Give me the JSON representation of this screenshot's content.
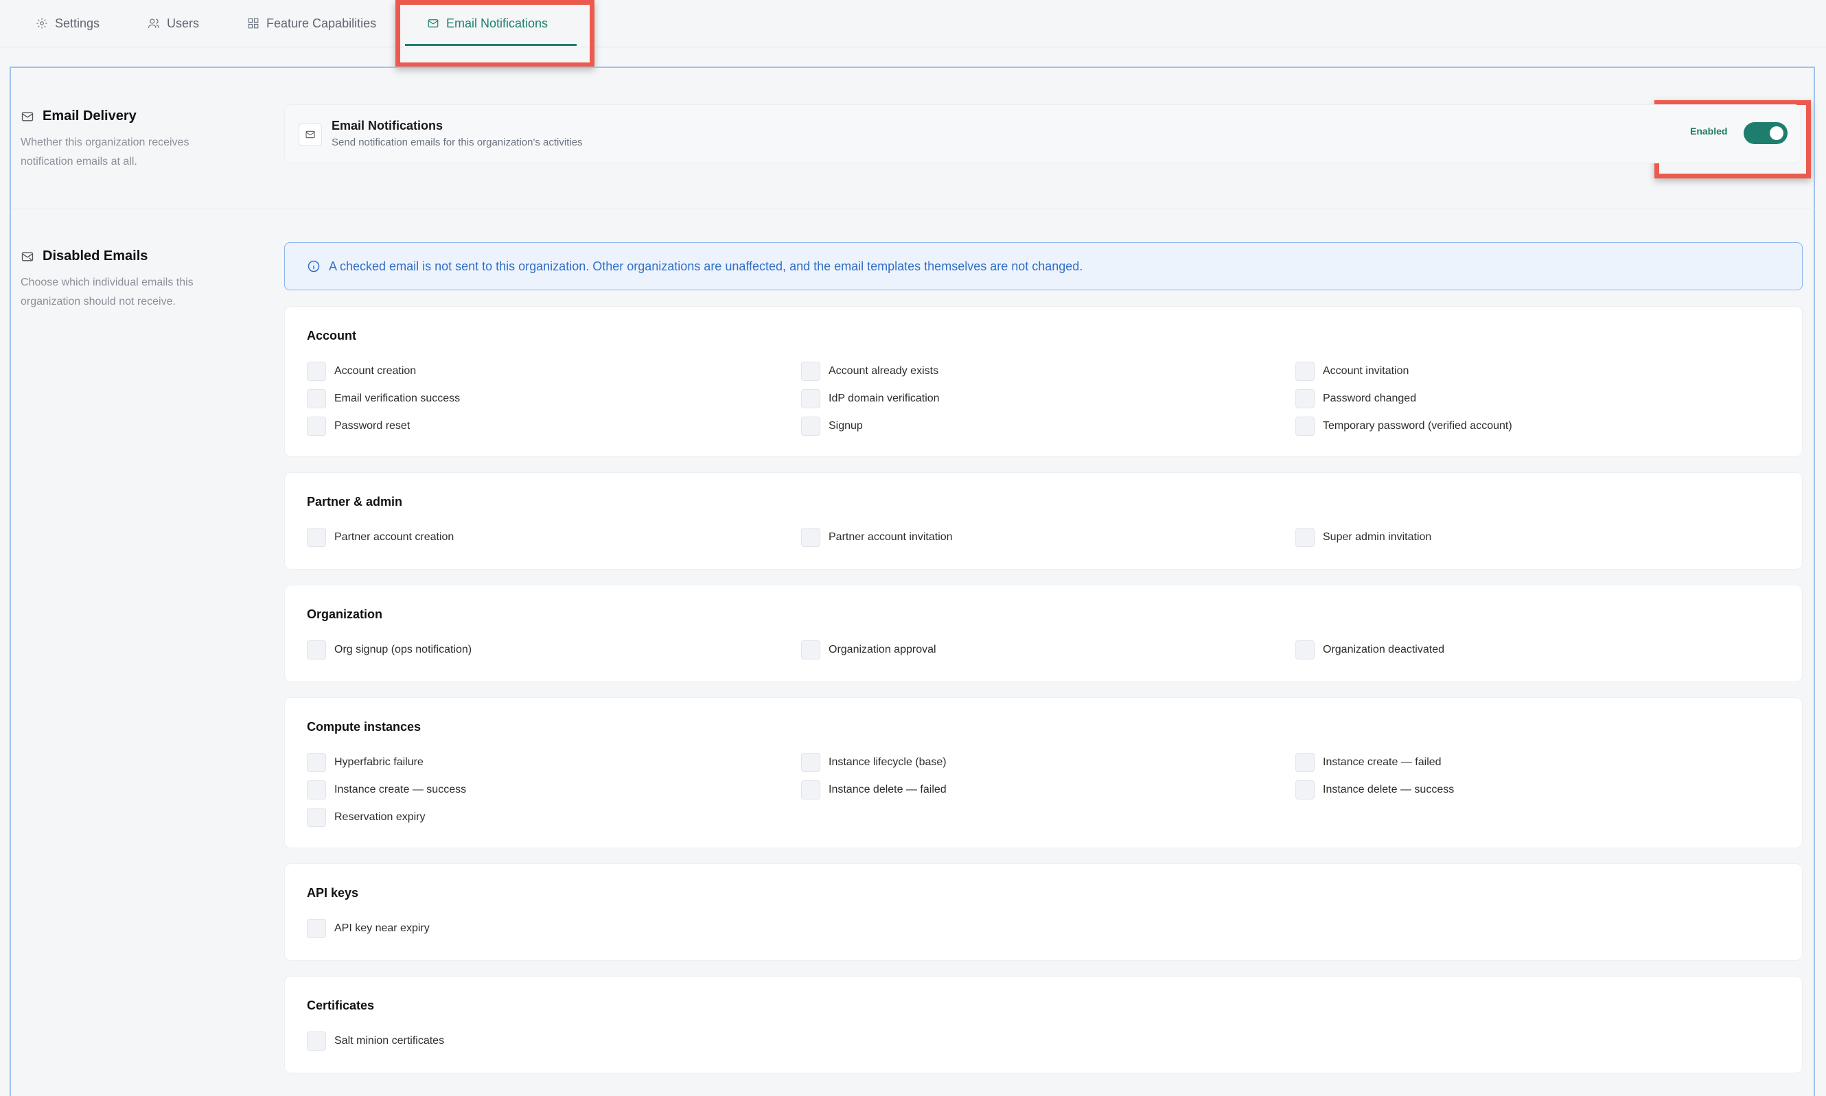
{
  "tabs": [
    {
      "label": "Settings",
      "icon": "gear-icon"
    },
    {
      "label": "Users",
      "icon": "users-icon"
    },
    {
      "label": "Feature Capabilities",
      "icon": "grid-icon"
    },
    {
      "label": "Email Notifications",
      "icon": "mail-icon",
      "active": true
    }
  ],
  "email_delivery": {
    "heading": "Email Delivery",
    "description": "Whether this organization receives notification emails at all.",
    "card_title": "Email Notifications",
    "card_subtitle": "Send notification emails for this organization's activities",
    "status_label": "Enabled",
    "enabled": true
  },
  "disabled_emails": {
    "heading": "Disabled Emails",
    "description": "Choose which individual emails this organization should not receive.",
    "info": "A checked email is not sent to this organization. Other organizations are unaffected, and the email templates themselves are not changed.",
    "groups": [
      {
        "title": "Account",
        "items": [
          "Account creation",
          "Account already exists",
          "Account invitation",
          "Email verification success",
          "IdP domain verification",
          "Password changed",
          "Password reset",
          "Signup",
          "Temporary password (verified account)"
        ]
      },
      {
        "title": "Partner & admin",
        "items": [
          "Partner account creation",
          "Partner account invitation",
          "Super admin invitation"
        ]
      },
      {
        "title": "Organization",
        "items": [
          "Org signup (ops notification)",
          "Organization approval",
          "Organization deactivated"
        ]
      },
      {
        "title": "Compute instances",
        "items": [
          "Hyperfabric failure",
          "Instance lifecycle (base)",
          "Instance create — failed",
          "Instance create — success",
          "Instance delete — failed",
          "Instance delete — success",
          "Reservation expiry"
        ]
      },
      {
        "title": "API keys",
        "items": [
          "API key near expiry"
        ]
      },
      {
        "title": "Certificates",
        "items": [
          "Salt minion certificates"
        ]
      }
    ]
  },
  "colors": {
    "accent": "#1e7e6e",
    "info": "#2f6fc9",
    "annotation": "#ec5a4d"
  }
}
